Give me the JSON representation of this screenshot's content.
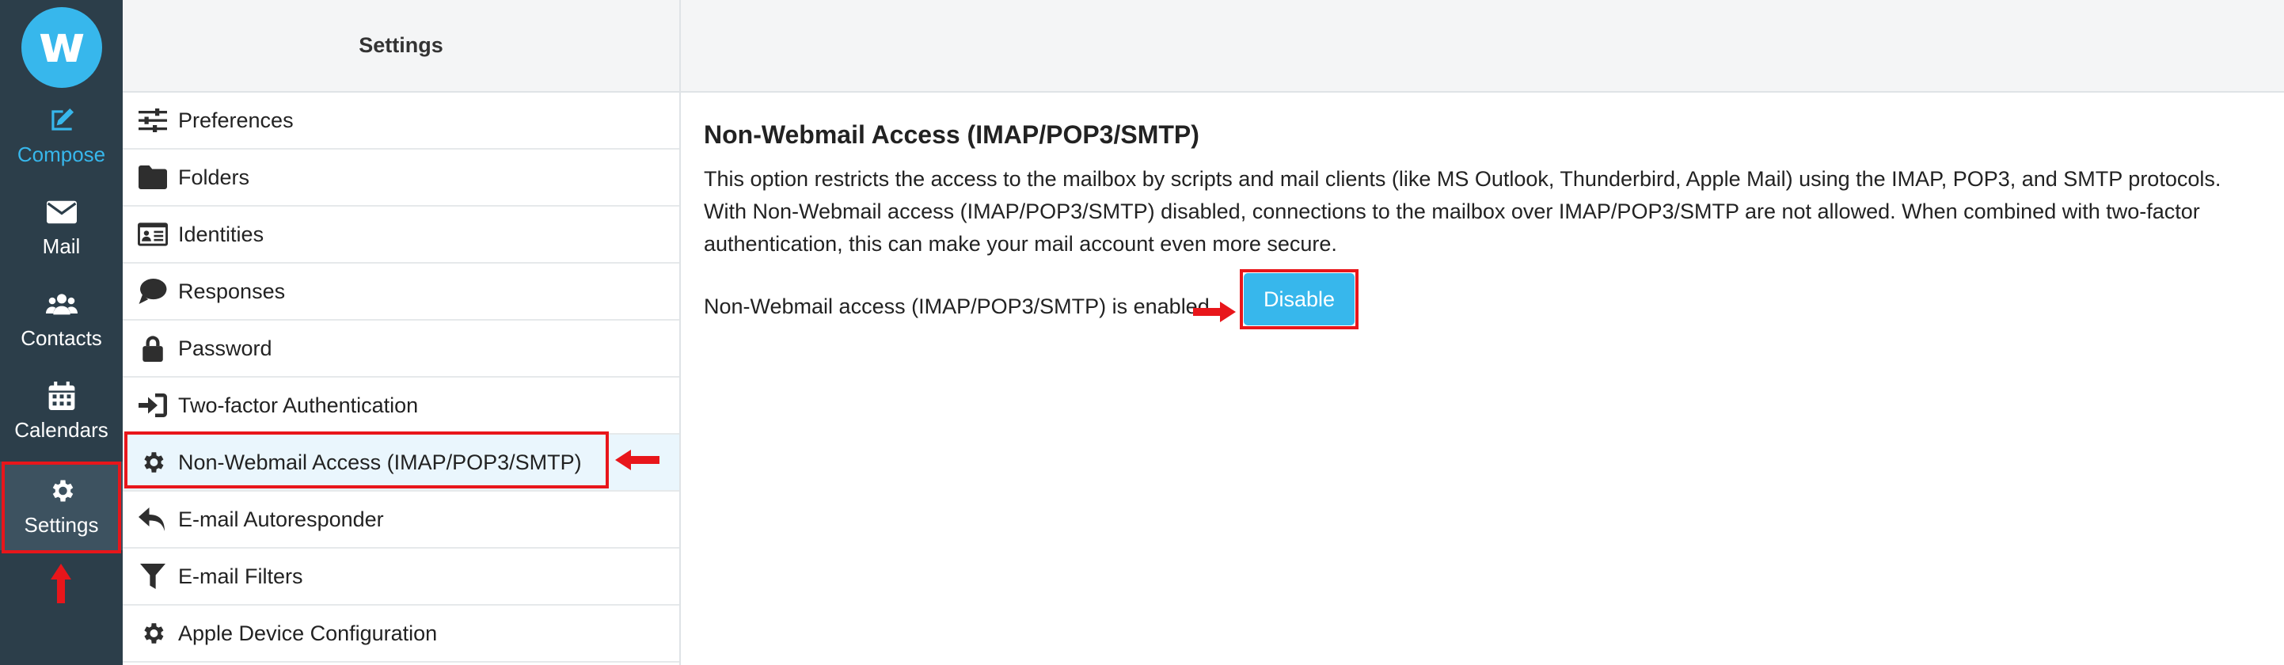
{
  "logo": {
    "letter": "w"
  },
  "nav": {
    "items": [
      {
        "label": "Compose",
        "icon": "compose-icon"
      },
      {
        "label": "Mail",
        "icon": "envelope-icon"
      },
      {
        "label": "Contacts",
        "icon": "users-icon"
      },
      {
        "label": "Calendars",
        "icon": "calendar-icon"
      },
      {
        "label": "Settings",
        "icon": "gear-icon"
      }
    ]
  },
  "settings": {
    "title": "Settings",
    "items": [
      {
        "label": "Preferences",
        "icon": "sliders-icon"
      },
      {
        "label": "Folders",
        "icon": "folder-icon"
      },
      {
        "label": "Identities",
        "icon": "id-card-icon"
      },
      {
        "label": "Responses",
        "icon": "speech-bubble-icon"
      },
      {
        "label": "Password",
        "icon": "lock-icon"
      },
      {
        "label": "Two-factor Authentication",
        "icon": "sign-in-icon"
      },
      {
        "label": "Non-Webmail Access (IMAP/POP3/SMTP)",
        "icon": "gear-icon"
      },
      {
        "label": "E-mail Autoresponder",
        "icon": "reply-icon"
      },
      {
        "label": "E-mail Filters",
        "icon": "filter-icon"
      },
      {
        "label": "Apple Device Configuration",
        "icon": "gear-icon"
      }
    ]
  },
  "content": {
    "title": "Non-Webmail Access (IMAP/POP3/SMTP)",
    "desc_line1": "This option restricts the access to the mailbox by scripts and mail clients (like MS Outlook, Thunderbird, Apple Mail) using the IMAP, POP3, and SMTP protocols.",
    "desc_line2": "With Non-Webmail access (IMAP/POP3/SMTP) disabled, connections to the mailbox over IMAP/POP3/SMTP are not allowed. When combined with two-factor",
    "desc_line3": "authentication, this can make your mail account even more secure.",
    "status": "Non-Webmail access (IMAP/POP3/SMTP) is enabled",
    "disable_label": "Disable"
  },
  "colors": {
    "accent": "#37b7ec",
    "nav_bg": "#2c3e4a",
    "highlight": "#e8161b"
  }
}
